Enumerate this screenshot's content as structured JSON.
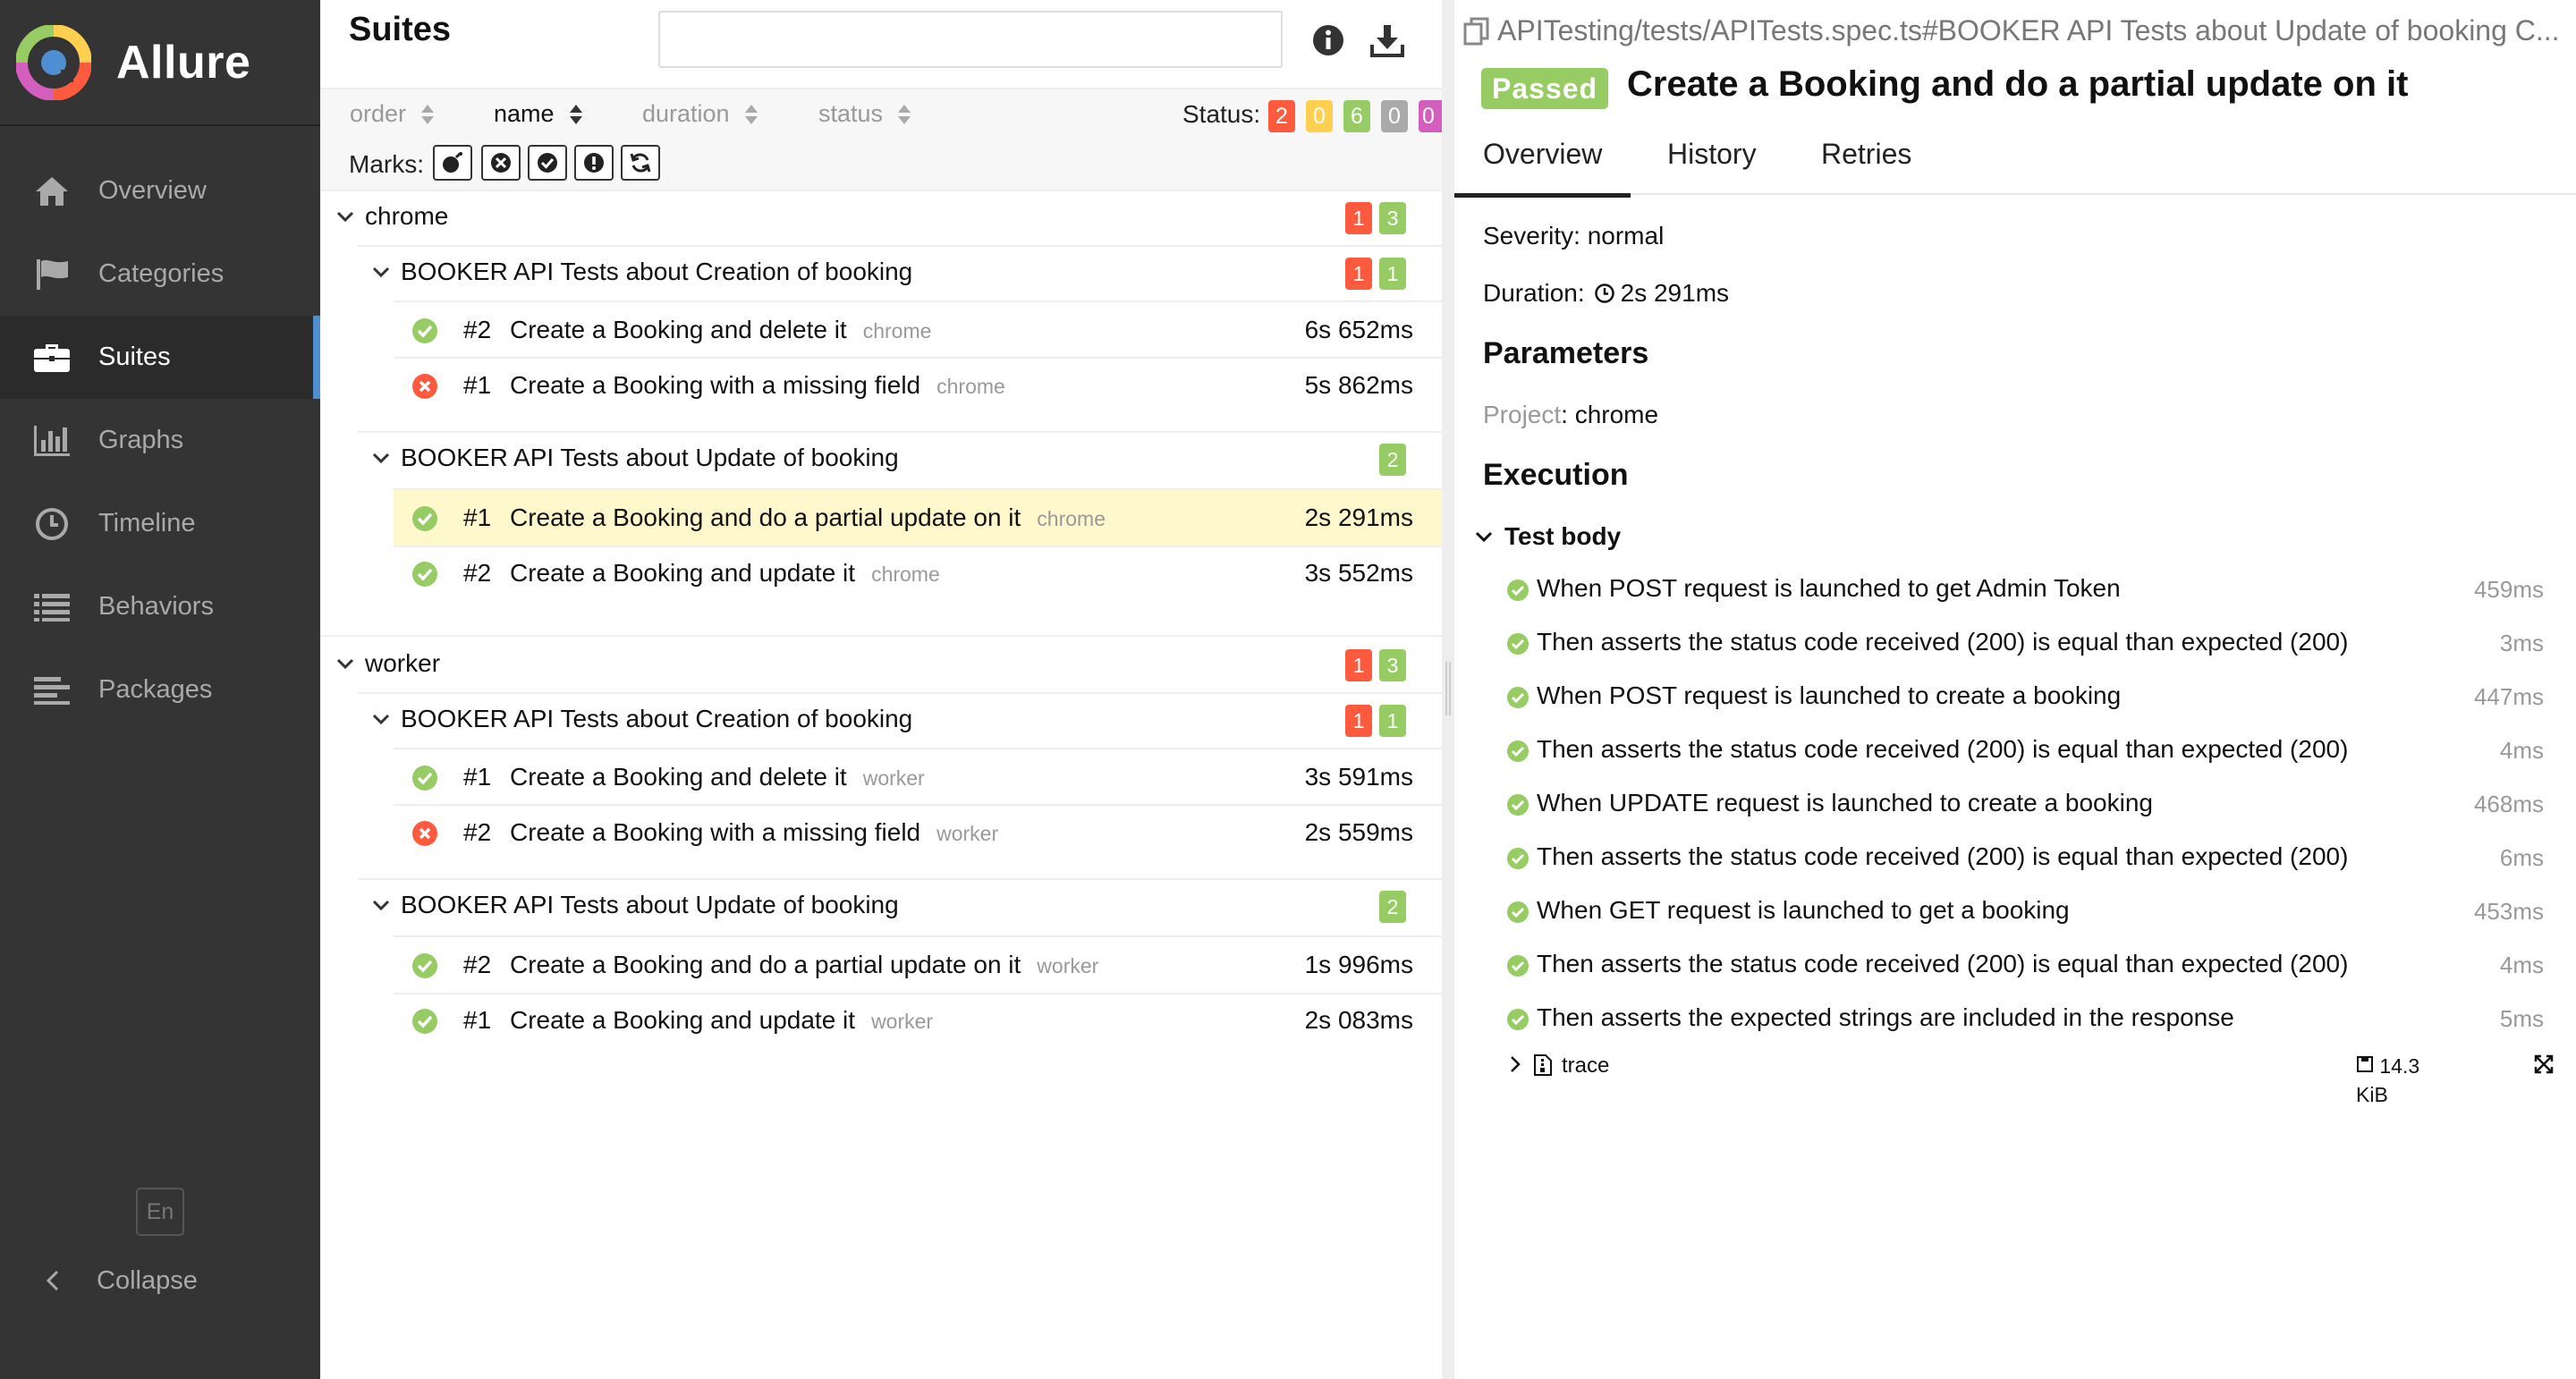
{
  "app": {
    "name": "Allure",
    "logo_icon": "allure-logo-icon"
  },
  "sidebar": {
    "items": [
      {
        "label": "Overview",
        "icon": "home-icon",
        "active": false
      },
      {
        "label": "Categories",
        "icon": "flag-icon",
        "active": false
      },
      {
        "label": "Suites",
        "icon": "briefcase-icon",
        "active": true
      },
      {
        "label": "Graphs",
        "icon": "bar-chart-icon",
        "active": false
      },
      {
        "label": "Timeline",
        "icon": "clock-icon",
        "active": false
      },
      {
        "label": "Behaviors",
        "icon": "list-icon",
        "active": false
      },
      {
        "label": "Packages",
        "icon": "align-left-icon",
        "active": false
      }
    ],
    "language": "En",
    "collapse_label": "Collapse"
  },
  "suites": {
    "title": "Suites",
    "search_value": "",
    "sort": {
      "order": "order",
      "name": "name",
      "duration": "duration",
      "status": "status"
    },
    "status_label": "Status:",
    "status_counts": [
      {
        "value": "2",
        "status": "failed",
        "color": "#fd5a3e"
      },
      {
        "value": "0",
        "status": "broken",
        "color": "#ffd050"
      },
      {
        "value": "6",
        "status": "passed",
        "color": "#97cc64"
      },
      {
        "value": "0",
        "status": "skipped",
        "color": "#aaaaaa"
      },
      {
        "value": "0",
        "status": "unknown",
        "color": "#d35ebe"
      }
    ],
    "marks_label": "Marks:",
    "groups": [
      {
        "name": "chrome",
        "failed": "1",
        "passed": "3",
        "subgroups": [
          {
            "name": "BOOKER API Tests about Creation of booking",
            "failed": "1",
            "passed": "1",
            "tests": [
              {
                "num": "#2",
                "name": "Create a Booking and delete it",
                "tag": "chrome",
                "duration": "6s 652ms",
                "status": "passed"
              },
              {
                "num": "#1",
                "name": "Create a Booking with a missing field",
                "tag": "chrome",
                "duration": "5s 862ms",
                "status": "failed"
              }
            ]
          },
          {
            "name": "BOOKER API Tests about Update of booking",
            "passed": "2",
            "tests": [
              {
                "num": "#1",
                "name": "Create a Booking and do a partial update on it",
                "tag": "chrome",
                "duration": "2s 291ms",
                "status": "passed",
                "selected": true
              },
              {
                "num": "#2",
                "name": "Create a Booking and update it",
                "tag": "chrome",
                "duration": "3s 552ms",
                "status": "passed"
              }
            ]
          }
        ]
      },
      {
        "name": "worker",
        "failed": "1",
        "passed": "3",
        "subgroups": [
          {
            "name": "BOOKER API Tests about Creation of booking",
            "failed": "1",
            "passed": "1",
            "tests": [
              {
                "num": "#1",
                "name": "Create a Booking and delete it",
                "tag": "worker",
                "duration": "3s 591ms",
                "status": "passed"
              },
              {
                "num": "#2",
                "name": "Create a Booking with a missing field",
                "tag": "worker",
                "duration": "2s 559ms",
                "status": "failed"
              }
            ]
          },
          {
            "name": "BOOKER API Tests about Update of booking",
            "passed": "2",
            "tests": [
              {
                "num": "#2",
                "name": "Create a Booking and do a partial update on it",
                "tag": "worker",
                "duration": "1s 996ms",
                "status": "passed"
              },
              {
                "num": "#1",
                "name": "Create a Booking and update it",
                "tag": "worker",
                "duration": "2s 083ms",
                "status": "passed"
              }
            ]
          }
        ]
      }
    ]
  },
  "detail": {
    "breadcrumb": "APITesting/tests/APITests.spec.ts#BOOKER API Tests about Update of booking C...",
    "status": "Passed",
    "title": "Create a Booking and do a partial update on it",
    "tabs": [
      "Overview",
      "History",
      "Retries"
    ],
    "severity": "Severity: normal",
    "duration_label": "Duration:",
    "duration_value": "2s 291ms",
    "parameters_heading": "Parameters",
    "param_key": "Project",
    "param_value": ": chrome",
    "execution_heading": "Execution",
    "test_body_label": "Test body",
    "steps": [
      {
        "name": "When POST request is launched to get Admin Token",
        "duration": "459ms"
      },
      {
        "name": "Then asserts the status code received (200) is equal than expected (200)",
        "duration": "3ms"
      },
      {
        "name": "When POST request is launched to create a booking",
        "duration": "447ms"
      },
      {
        "name": "Then asserts the status code received (200) is equal than expected (200)",
        "duration": "4ms"
      },
      {
        "name": "When UPDATE request is launched to create a booking",
        "duration": "468ms"
      },
      {
        "name": "Then asserts the status code received (200) is equal than expected (200)",
        "duration": "6ms"
      },
      {
        "name": "When GET request is launched to get a booking",
        "duration": "453ms"
      },
      {
        "name": "Then asserts the status code received (200) is equal than expected (200)",
        "duration": "4ms"
      },
      {
        "name": "Then asserts the expected strings are included in the response",
        "duration": "5ms"
      }
    ],
    "attachment": {
      "name": "trace",
      "size_line1": "14.3",
      "size_line2": "KiB"
    }
  },
  "colors": {
    "passed": "#97cc64",
    "failed": "#fd5a3e",
    "sidebar_bg": "#343434",
    "accent": "#4d8fd1",
    "selected_row": "#fff8cc"
  }
}
